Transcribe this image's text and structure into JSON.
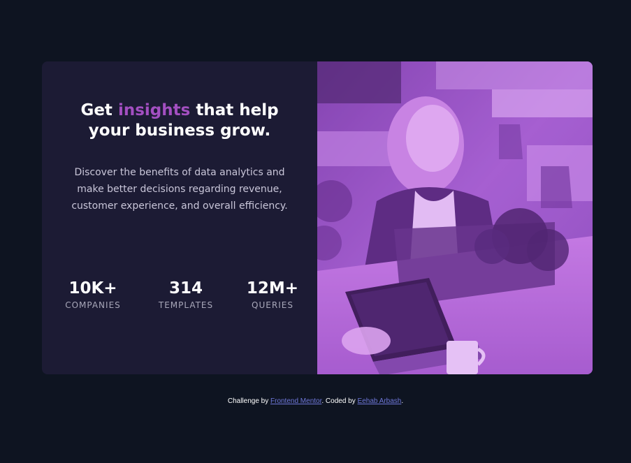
{
  "card": {
    "headline": {
      "prefix": "Get",
      "accent": "insights",
      "suffix": "that help your business grow."
    },
    "description": "Discover the benefits of data analytics and make better decisions regarding revenue, customer experience, and overall efficiency.",
    "stats": [
      {
        "value": "10K+",
        "label": "COMPANIES"
      },
      {
        "value": "314",
        "label": "TEMPLATES"
      },
      {
        "value": "12M+",
        "label": "QUERIES"
      }
    ]
  },
  "footer": {
    "challenge_prefix": "Challenge by",
    "challenge_link": "Frontend Mentor",
    "coded_prefix": ". Coded by",
    "author_link": "Eehab Arbash",
    "end": "."
  },
  "colors": {
    "background": "#0e1421",
    "card": "#1c1b34",
    "accent": "#a34fc1",
    "image_tint": "#9a55c9",
    "link": "#6e77d8"
  }
}
